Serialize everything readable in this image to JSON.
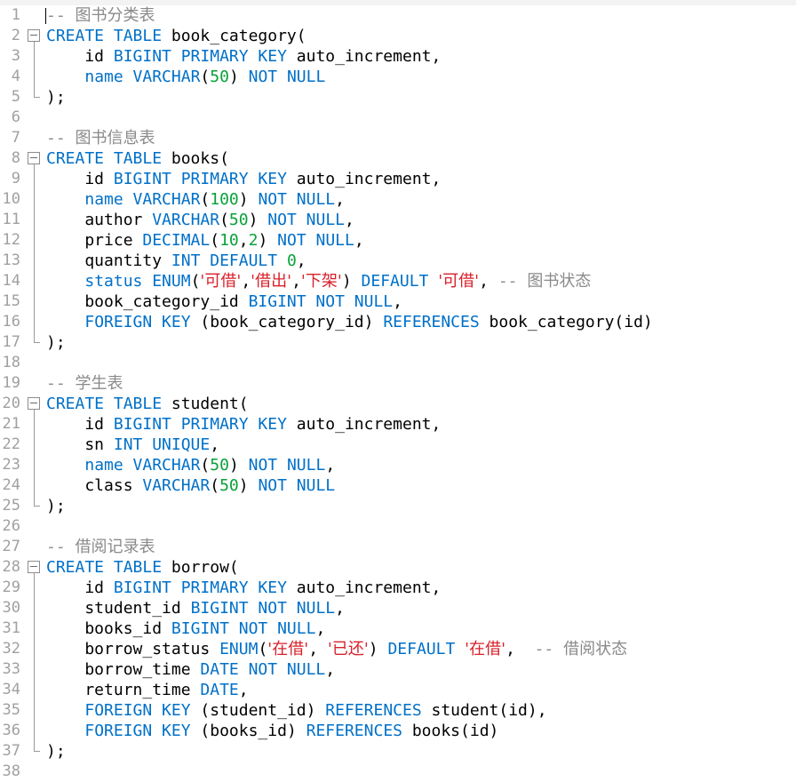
{
  "colors": {
    "keyword": "#0070c8",
    "number": "#09a13a",
    "string": "#d8202a",
    "comment": "#8a8a8a",
    "text": "#000000",
    "line_number": "#a0a0a0"
  },
  "lines": [
    {
      "n": "1",
      "fold": "none",
      "tokens": [
        {
          "t": "-- 图书分类表",
          "c": "cmt"
        }
      ]
    },
    {
      "n": "2",
      "fold": "start",
      "tokens": [
        {
          "t": "CREATE TABLE",
          "c": "kw"
        },
        {
          "t": " book_category(",
          "c": ""
        }
      ]
    },
    {
      "n": "3",
      "fold": "mid",
      "tokens": [
        {
          "t": "    id ",
          "c": ""
        },
        {
          "t": "BIGINT PRIMARY KEY",
          "c": "kw"
        },
        {
          "t": " auto_increment,",
          "c": ""
        }
      ]
    },
    {
      "n": "4",
      "fold": "mid",
      "tokens": [
        {
          "t": "    ",
          "c": ""
        },
        {
          "t": "name VARCHAR",
          "c": "kw"
        },
        {
          "t": "(",
          "c": ""
        },
        {
          "t": "50",
          "c": "num"
        },
        {
          "t": ") ",
          "c": ""
        },
        {
          "t": "NOT NULL",
          "c": "kw"
        }
      ]
    },
    {
      "n": "5",
      "fold": "end",
      "tokens": [
        {
          "t": ");",
          "c": ""
        }
      ]
    },
    {
      "n": "6",
      "fold": "none",
      "tokens": []
    },
    {
      "n": "7",
      "fold": "none",
      "tokens": [
        {
          "t": "-- 图书信息表",
          "c": "cmt"
        }
      ]
    },
    {
      "n": "8",
      "fold": "start",
      "tokens": [
        {
          "t": "CREATE TABLE",
          "c": "kw"
        },
        {
          "t": " books(",
          "c": ""
        }
      ]
    },
    {
      "n": "9",
      "fold": "mid",
      "tokens": [
        {
          "t": "    id ",
          "c": ""
        },
        {
          "t": "BIGINT PRIMARY KEY",
          "c": "kw"
        },
        {
          "t": " auto_increment,",
          "c": ""
        }
      ]
    },
    {
      "n": "10",
      "fold": "mid",
      "tokens": [
        {
          "t": "    ",
          "c": ""
        },
        {
          "t": "name VARCHAR",
          "c": "kw"
        },
        {
          "t": "(",
          "c": ""
        },
        {
          "t": "100",
          "c": "num"
        },
        {
          "t": ") ",
          "c": ""
        },
        {
          "t": "NOT NULL",
          "c": "kw"
        },
        {
          "t": ",",
          "c": ""
        }
      ]
    },
    {
      "n": "11",
      "fold": "mid",
      "tokens": [
        {
          "t": "    author ",
          "c": ""
        },
        {
          "t": "VARCHAR",
          "c": "kw"
        },
        {
          "t": "(",
          "c": ""
        },
        {
          "t": "50",
          "c": "num"
        },
        {
          "t": ") ",
          "c": ""
        },
        {
          "t": "NOT NULL",
          "c": "kw"
        },
        {
          "t": ",",
          "c": ""
        }
      ]
    },
    {
      "n": "12",
      "fold": "mid",
      "tokens": [
        {
          "t": "    price ",
          "c": ""
        },
        {
          "t": "DECIMAL",
          "c": "kw"
        },
        {
          "t": "(",
          "c": ""
        },
        {
          "t": "10",
          "c": "num"
        },
        {
          "t": ",",
          "c": ""
        },
        {
          "t": "2",
          "c": "num"
        },
        {
          "t": ") ",
          "c": ""
        },
        {
          "t": "NOT NULL",
          "c": "kw"
        },
        {
          "t": ",",
          "c": ""
        }
      ]
    },
    {
      "n": "13",
      "fold": "mid",
      "tokens": [
        {
          "t": "    quantity ",
          "c": ""
        },
        {
          "t": "INT DEFAULT",
          "c": "kw"
        },
        {
          "t": " ",
          "c": ""
        },
        {
          "t": "0",
          "c": "num"
        },
        {
          "t": ",",
          "c": ""
        }
      ]
    },
    {
      "n": "14",
      "fold": "mid",
      "tokens": [
        {
          "t": "    ",
          "c": ""
        },
        {
          "t": "status ENUM",
          "c": "kw"
        },
        {
          "t": "(",
          "c": ""
        },
        {
          "t": "'可借'",
          "c": "str"
        },
        {
          "t": ",",
          "c": ""
        },
        {
          "t": "'借出'",
          "c": "str"
        },
        {
          "t": ",",
          "c": ""
        },
        {
          "t": "'下架'",
          "c": "str"
        },
        {
          "t": ") ",
          "c": ""
        },
        {
          "t": "DEFAULT",
          "c": "kw"
        },
        {
          "t": " ",
          "c": ""
        },
        {
          "t": "'可借'",
          "c": "str"
        },
        {
          "t": ", ",
          "c": ""
        },
        {
          "t": "-- 图书状态",
          "c": "cmt"
        }
      ]
    },
    {
      "n": "15",
      "fold": "mid",
      "tokens": [
        {
          "t": "    book_category_id ",
          "c": ""
        },
        {
          "t": "BIGINT NOT NULL",
          "c": "kw"
        },
        {
          "t": ",",
          "c": ""
        }
      ]
    },
    {
      "n": "16",
      "fold": "mid",
      "tokens": [
        {
          "t": "    ",
          "c": ""
        },
        {
          "t": "FOREIGN KEY",
          "c": "kw"
        },
        {
          "t": " (book_category_id) ",
          "c": ""
        },
        {
          "t": "REFERENCES",
          "c": "kw"
        },
        {
          "t": " book_category(id)",
          "c": ""
        }
      ]
    },
    {
      "n": "17",
      "fold": "end",
      "tokens": [
        {
          "t": ");",
          "c": ""
        }
      ]
    },
    {
      "n": "18",
      "fold": "none",
      "tokens": []
    },
    {
      "n": "19",
      "fold": "none",
      "tokens": [
        {
          "t": "-- 学生表",
          "c": "cmt"
        }
      ]
    },
    {
      "n": "20",
      "fold": "start",
      "tokens": [
        {
          "t": "CREATE TABLE",
          "c": "kw"
        },
        {
          "t": " student(",
          "c": ""
        }
      ]
    },
    {
      "n": "21",
      "fold": "mid",
      "tokens": [
        {
          "t": "    id ",
          "c": ""
        },
        {
          "t": "BIGINT PRIMARY KEY",
          "c": "kw"
        },
        {
          "t": " auto_increment,",
          "c": ""
        }
      ]
    },
    {
      "n": "22",
      "fold": "mid",
      "tokens": [
        {
          "t": "    sn ",
          "c": ""
        },
        {
          "t": "INT UNIQUE",
          "c": "kw"
        },
        {
          "t": ",",
          "c": ""
        }
      ]
    },
    {
      "n": "23",
      "fold": "mid",
      "tokens": [
        {
          "t": "    ",
          "c": ""
        },
        {
          "t": "name VARCHAR",
          "c": "kw"
        },
        {
          "t": "(",
          "c": ""
        },
        {
          "t": "50",
          "c": "num"
        },
        {
          "t": ") ",
          "c": ""
        },
        {
          "t": "NOT NULL",
          "c": "kw"
        },
        {
          "t": ",",
          "c": ""
        }
      ]
    },
    {
      "n": "24",
      "fold": "mid",
      "tokens": [
        {
          "t": "    class ",
          "c": ""
        },
        {
          "t": "VARCHAR",
          "c": "kw"
        },
        {
          "t": "(",
          "c": ""
        },
        {
          "t": "50",
          "c": "num"
        },
        {
          "t": ") ",
          "c": ""
        },
        {
          "t": "NOT NULL",
          "c": "kw"
        }
      ]
    },
    {
      "n": "25",
      "fold": "end",
      "tokens": [
        {
          "t": ");",
          "c": ""
        }
      ]
    },
    {
      "n": "26",
      "fold": "none",
      "tokens": []
    },
    {
      "n": "27",
      "fold": "none",
      "tokens": [
        {
          "t": "-- 借阅记录表",
          "c": "cmt"
        }
      ]
    },
    {
      "n": "28",
      "fold": "start",
      "tokens": [
        {
          "t": "CREATE TABLE",
          "c": "kw"
        },
        {
          "t": " borrow(",
          "c": ""
        }
      ]
    },
    {
      "n": "29",
      "fold": "mid",
      "tokens": [
        {
          "t": "    id ",
          "c": ""
        },
        {
          "t": "BIGINT PRIMARY KEY",
          "c": "kw"
        },
        {
          "t": " auto_increment,",
          "c": ""
        }
      ]
    },
    {
      "n": "30",
      "fold": "mid",
      "tokens": [
        {
          "t": "    student_id ",
          "c": ""
        },
        {
          "t": "BIGINT NOT NULL",
          "c": "kw"
        },
        {
          "t": ",",
          "c": ""
        }
      ]
    },
    {
      "n": "31",
      "fold": "mid",
      "tokens": [
        {
          "t": "    books_id ",
          "c": ""
        },
        {
          "t": "BIGINT NOT NULL",
          "c": "kw"
        },
        {
          "t": ",",
          "c": ""
        }
      ]
    },
    {
      "n": "32",
      "fold": "mid",
      "tokens": [
        {
          "t": "    borrow_status ",
          "c": ""
        },
        {
          "t": "ENUM",
          "c": "kw"
        },
        {
          "t": "(",
          "c": ""
        },
        {
          "t": "'在借'",
          "c": "str"
        },
        {
          "t": ", ",
          "c": ""
        },
        {
          "t": "'已还'",
          "c": "str"
        },
        {
          "t": ") ",
          "c": ""
        },
        {
          "t": "DEFAULT",
          "c": "kw"
        },
        {
          "t": " ",
          "c": ""
        },
        {
          "t": "'在借'",
          "c": "str"
        },
        {
          "t": ",  ",
          "c": ""
        },
        {
          "t": "-- 借阅状态",
          "c": "cmt"
        }
      ]
    },
    {
      "n": "33",
      "fold": "mid",
      "tokens": [
        {
          "t": "    borrow_time ",
          "c": ""
        },
        {
          "t": "DATE NOT NULL",
          "c": "kw"
        },
        {
          "t": ",",
          "c": ""
        }
      ]
    },
    {
      "n": "34",
      "fold": "mid",
      "tokens": [
        {
          "t": "    return_time ",
          "c": ""
        },
        {
          "t": "DATE",
          "c": "kw"
        },
        {
          "t": ",",
          "c": ""
        }
      ]
    },
    {
      "n": "35",
      "fold": "mid",
      "tokens": [
        {
          "t": "    ",
          "c": ""
        },
        {
          "t": "FOREIGN KEY",
          "c": "kw"
        },
        {
          "t": " (student_id) ",
          "c": ""
        },
        {
          "t": "REFERENCES",
          "c": "kw"
        },
        {
          "t": " student(id),",
          "c": ""
        }
      ]
    },
    {
      "n": "36",
      "fold": "mid",
      "tokens": [
        {
          "t": "    ",
          "c": ""
        },
        {
          "t": "FOREIGN KEY",
          "c": "kw"
        },
        {
          "t": " (books_id) ",
          "c": ""
        },
        {
          "t": "REFERENCES",
          "c": "kw"
        },
        {
          "t": " books(id)",
          "c": ""
        }
      ]
    },
    {
      "n": "37",
      "fold": "end",
      "tokens": [
        {
          "t": ");",
          "c": ""
        }
      ]
    },
    {
      "n": "38",
      "fold": "none",
      "tokens": []
    }
  ]
}
